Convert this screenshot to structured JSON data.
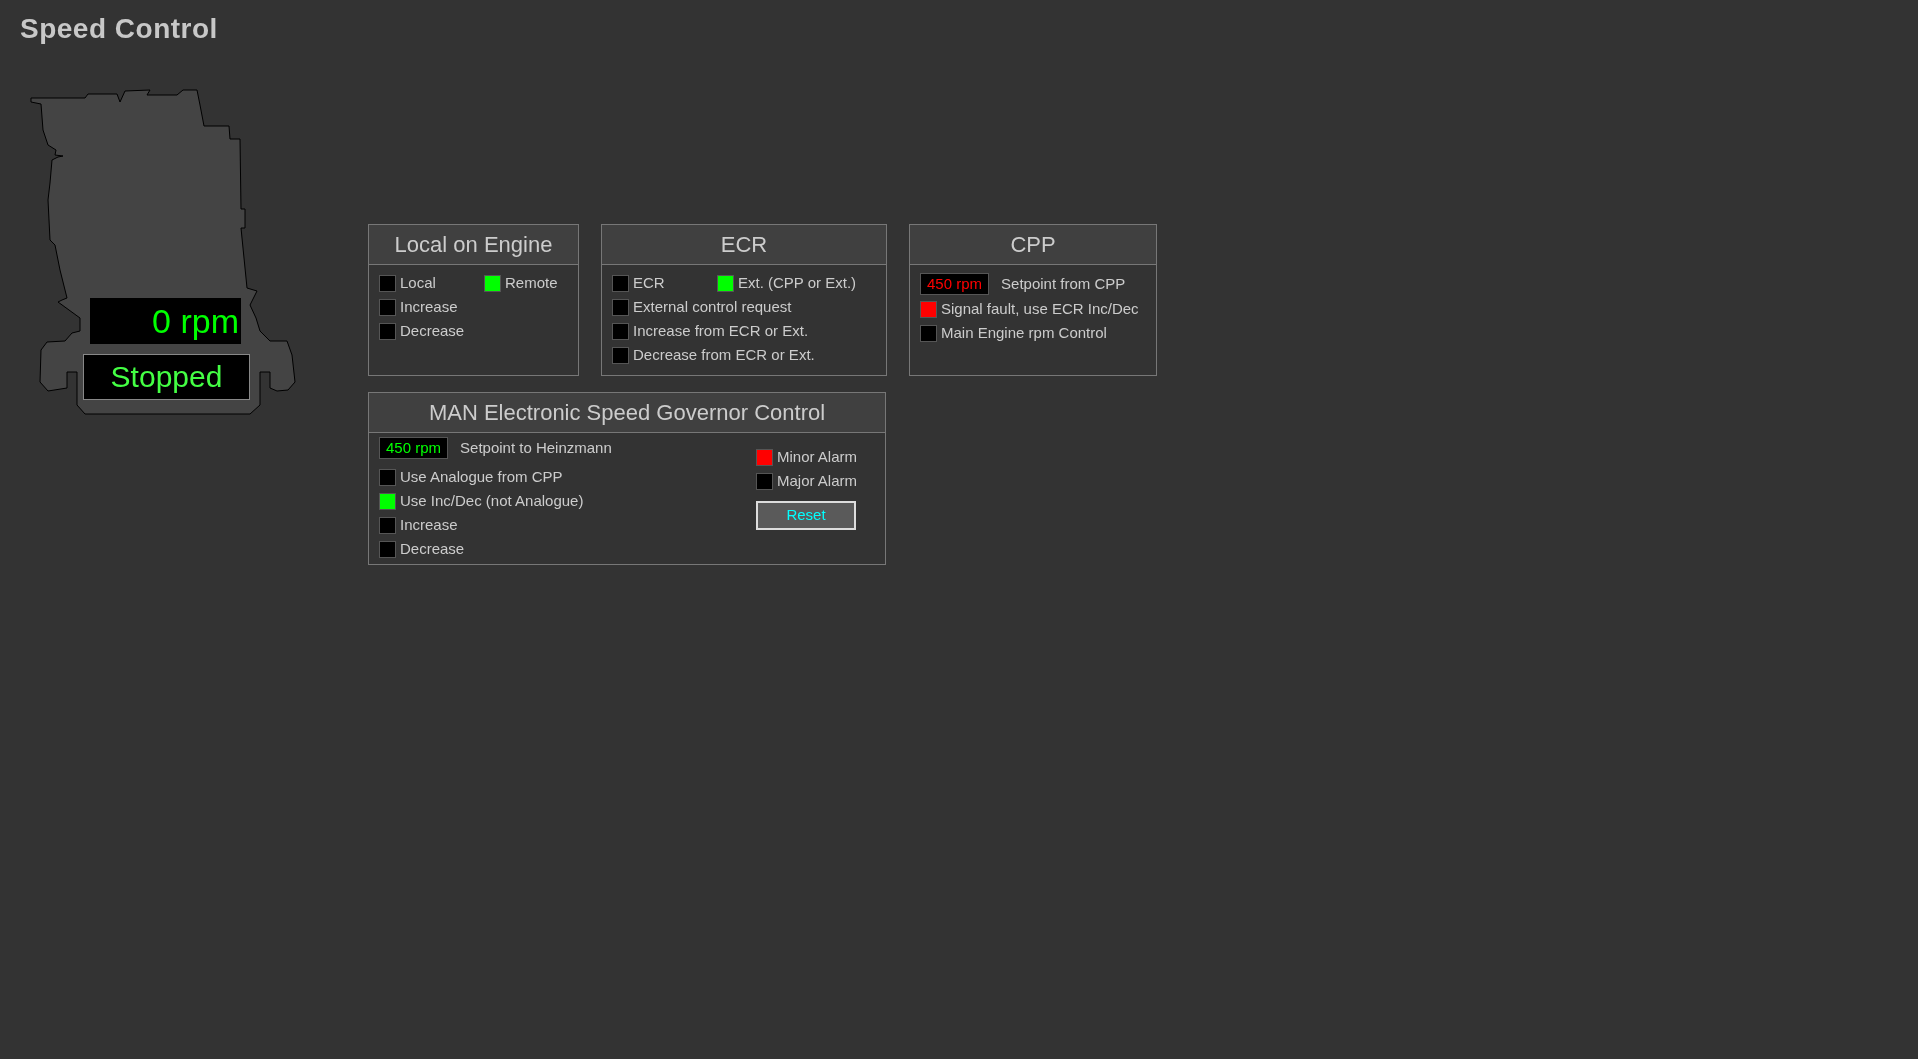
{
  "title": "Speed Control",
  "engine": {
    "speed": "0 rpm",
    "status": "Stopped"
  },
  "panels": [
    {
      "title": "Local on Engine",
      "rows": [
        [
          {
            "kind": "lamp",
            "label": "Local",
            "color": "#000000"
          },
          {
            "kind": "lamp",
            "label": "Remote",
            "color": "#00ff00"
          }
        ],
        [
          {
            "kind": "lamp",
            "label": "Increase",
            "color": "#000000"
          }
        ],
        [
          {
            "kind": "lamp",
            "label": "Decrease",
            "color": "#000000"
          }
        ]
      ]
    },
    {
      "title": "ECR",
      "rows": [
        [
          {
            "kind": "lamp",
            "label": "ECR",
            "color": "#000000"
          },
          {
            "kind": "lamp",
            "label": "Ext. (CPP or Ext.)",
            "color": "#00ff00"
          }
        ],
        [
          {
            "kind": "lamp",
            "label": "External control request",
            "color": "#000000"
          }
        ],
        [
          {
            "kind": "lamp",
            "label": "Increase from ECR or Ext.",
            "color": "#000000"
          }
        ],
        [
          {
            "kind": "lamp",
            "label": "Decrease from ECR or Ext.",
            "color": "#000000"
          }
        ]
      ]
    },
    {
      "title": "CPP",
      "rows": [
        [
          {
            "kind": "display",
            "value": "450 rpm",
            "label": "Setpoint from CPP",
            "alarm": true
          }
        ],
        [
          {
            "kind": "lamp",
            "label": "Signal fault, use ECR Inc/Dec",
            "color": "#ff0000"
          }
        ],
        [
          {
            "kind": "lamp",
            "label": "Main Engine rpm Control",
            "color": "#000000"
          }
        ]
      ]
    }
  ],
  "governor": {
    "title": "MAN Electronic Speed Governor Control",
    "left": [
      {
        "kind": "display",
        "value": "450 rpm",
        "label": "Setpoint to Heinzmann",
        "alarm": false
      },
      {
        "kind": "lamp",
        "label": "Use Analogue from CPP",
        "color": "#000000"
      },
      {
        "kind": "lamp",
        "label": "Use Inc/Dec (not Analogue)",
        "color": "#00ff00"
      },
      {
        "kind": "lamp",
        "label": "Increase",
        "color": "#000000"
      },
      {
        "kind": "lamp",
        "label": "Decrease",
        "color": "#000000"
      }
    ],
    "right": [
      {
        "kind": "lamp",
        "label": "Minor Alarm",
        "color": "#ff0000"
      },
      {
        "kind": "lamp",
        "label": "Major Alarm",
        "color": "#000000"
      }
    ],
    "button": "Reset"
  }
}
